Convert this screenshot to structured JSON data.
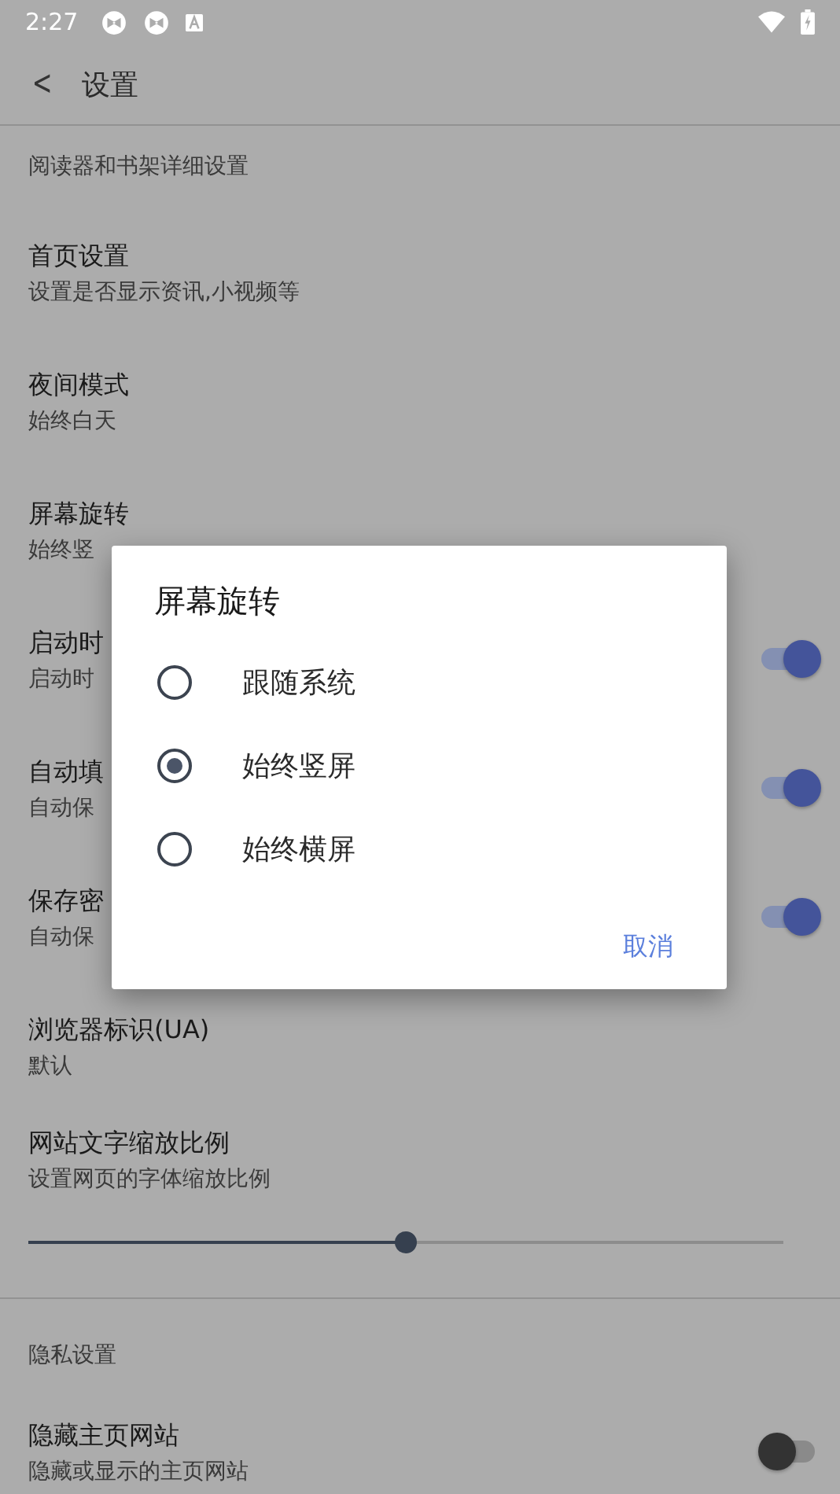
{
  "status_bar": {
    "time": "2:27"
  },
  "toolbar": {
    "back_icon": "<",
    "title": "设置"
  },
  "settings": [
    {
      "kind": "text",
      "subtitle": "阅读器和书架详细设置"
    },
    {
      "kind": "text",
      "title": "首页设置",
      "subtitle": "设置是否显示资讯,小视频等"
    },
    {
      "kind": "text",
      "title": "夜间模式",
      "subtitle": "始终白天"
    },
    {
      "kind": "text",
      "title": "屏幕旋转",
      "subtitle": "始终竖"
    },
    {
      "kind": "toggle",
      "title": "启动时",
      "subtitle": "启动时",
      "on": true
    },
    {
      "kind": "toggle",
      "title": "自动填",
      "subtitle": "自动保",
      "on": true
    },
    {
      "kind": "toggle",
      "title": "保存密",
      "subtitle": "自动保",
      "on": true
    },
    {
      "kind": "text",
      "title": "浏览器标识(UA)",
      "subtitle": "默认"
    },
    {
      "kind": "slider",
      "title": "网站文字缩放比例",
      "subtitle": "设置网页的字体缩放比例",
      "level": 0.5
    }
  ],
  "section": {
    "title": "隐私设置",
    "items": [
      {
        "kind": "toggle",
        "title": "隐藏主页网站",
        "subtitle": "隐藏或显示的主页网站",
        "on": false
      }
    ]
  },
  "dialog": {
    "title": "屏幕旋转",
    "options": [
      {
        "label": "跟随系统",
        "selected": false
      },
      {
        "label": "始终竖屏",
        "selected": true
      },
      {
        "label": "始终横屏",
        "selected": false
      }
    ],
    "buttons": [
      "取消"
    ]
  }
}
